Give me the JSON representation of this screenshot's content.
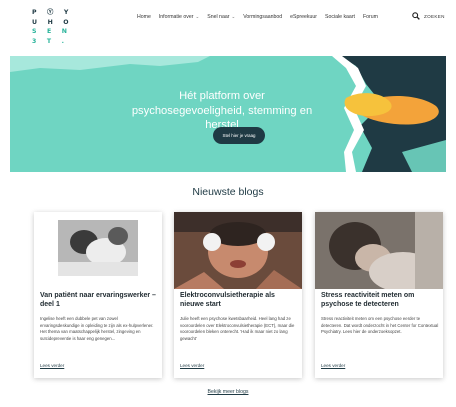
{
  "logo": {
    "rows": [
      "P Ⓨ Y",
      "U H O",
      "S E N",
      "3 T ."
    ],
    "teal_rows": [
      false,
      false,
      true,
      true
    ]
  },
  "nav": {
    "items": [
      {
        "label": "Home",
        "dropdown": false
      },
      {
        "label": "Informatie over",
        "dropdown": true
      },
      {
        "label": "Snel naar",
        "dropdown": true
      },
      {
        "label": "Vormingsaanbod",
        "dropdown": false
      },
      {
        "label": "eSpreekuur",
        "dropdown": false
      },
      {
        "label": "Sociale kaart",
        "dropdown": false
      },
      {
        "label": "Forum",
        "dropdown": false
      }
    ],
    "search_label": "ZOEKEN"
  },
  "hero": {
    "title": "Hét platform over psychosegevoeligheid, stemming en herstel",
    "button": "Stel hier je vraag"
  },
  "blogs": {
    "section_title": "Nieuwste blogs",
    "cards": [
      {
        "title": "Van patiënt naar ervaringswerker – deel 1",
        "text": "Ingelise heeft een dubbele pet van zowel ervaringsdeskundige in opleiding te zijn als ex-hulpverlener. Het thema van maatschappelijk herstel, zingeving en suïcidepreventie is haar eng genegen...",
        "more": "Lees verder"
      },
      {
        "title": "Elektroconvulsietherapie als nieuwe start",
        "text": "Julie heeft een psychose kwetsbaarheid. Heel lang had ze vooroordelen over Elektroconvulsietherapie (ECT), maar die vooroordelen bleken onterecht. 'Had ik maar niet zo lang gewacht'",
        "more": "Lees verder"
      },
      {
        "title": "Stress reactiviteit meten om psychose te detecteren",
        "text": "Stress reactiviteit meten om een psychose eerder te detecteren. Dat wordt onderzocht in het Center for Contextual Psychiatry. Lees hier de onderzoeksopzet.",
        "more": "Lees verder"
      }
    ],
    "all_link": "Bekijk meer blogs"
  },
  "colors": {
    "teal": "#6fd5c2",
    "navy": "#1f3a44",
    "orange": "#f3a33a",
    "yellow": "#f6c23c"
  }
}
